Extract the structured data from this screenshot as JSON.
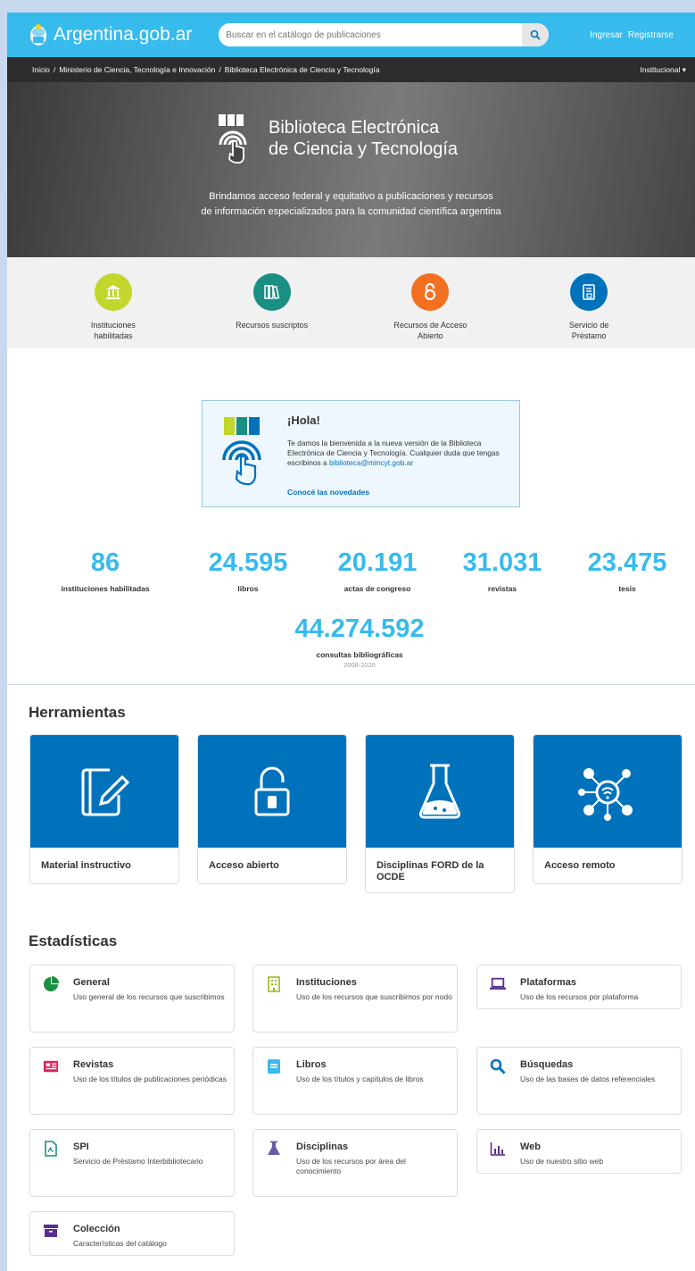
{
  "header": {
    "brand": "Argentina.gob.ar",
    "search_placeholder": "Buscar en el catálogo de publicaciones",
    "login": "Ingresar",
    "register": "Registrarse"
  },
  "breadcrumb": {
    "items": [
      "Inicio",
      "Ministerio de Ciencia, Tecnología e Innovación",
      "Biblioteca Electrónica de Ciencia y Tecnología"
    ],
    "institucional": "Institucional ▾"
  },
  "hero": {
    "title_line1": "Biblioteca Electrónica",
    "title_line2": "de Ciencia y Tecnología",
    "subtitle_line1": "Brindamos acceso federal y equitativo a publicaciones y recursos",
    "subtitle_line2": "de información especializados para la comunidad científica argentina"
  },
  "quick_links": [
    {
      "line1": "Instituciones",
      "line2": "habilitadas",
      "color": "#c2d62c",
      "icon": "institution-icon"
    },
    {
      "line1": "Recursos suscriptos",
      "line2": "",
      "color": "#1a8f83",
      "icon": "books-icon"
    },
    {
      "line1": "Recursos de Acceso",
      "line2": "Abierto",
      "color": "#f37021",
      "icon": "open-access-icon"
    },
    {
      "line1": "Servicio de",
      "line2": "Préstamo",
      "color": "#0072bb",
      "icon": "loan-icon"
    }
  ],
  "hola": {
    "title": "¡Hola!",
    "text": "Te damos la bienvenida a la nueva versión de la Biblioteca Electrónica de Ciencia y Tecnología. Cualquier duda que tengas escribinos a ",
    "email": "biblioteca@mincyt.gob.ar",
    "link": "Conocé las novedades"
  },
  "stats": {
    "instituciones": {
      "num": "86",
      "label": "instituciones habilitadas"
    },
    "libros": {
      "num": "24.595",
      "label": "libros"
    },
    "actas": {
      "num": "20.191",
      "label": "actas de congreso"
    },
    "revistas": {
      "num": "31.031",
      "label": "revistas"
    },
    "tesis": {
      "num": "23.475",
      "label": "tesis"
    },
    "consultas": {
      "num": "44.274.592",
      "label": "consultas bibliográficas",
      "years": "2008-2020"
    }
  },
  "herramientas": {
    "title": "Herramientas",
    "items": [
      {
        "label": "Material instructivo",
        "icon": "edit-document-icon"
      },
      {
        "label": "Acceso abierto",
        "icon": "unlock-icon"
      },
      {
        "label": "Disciplinas FORD de la OCDE",
        "icon": "flask-icon"
      },
      {
        "label": "Acceso remoto",
        "icon": "network-icon"
      }
    ]
  },
  "estadisticas": {
    "title": "Estadísticas",
    "items": [
      {
        "title": "General",
        "desc": "Uso general de los recursos que suscribimos",
        "icon": "pie-chart-icon",
        "color": "#1a8f43"
      },
      {
        "title": "Instituciones",
        "desc": "Uso de los recursos que suscribimos por nodo",
        "icon": "building-icon",
        "color": "#9cb81f"
      },
      {
        "title": "Plataformas",
        "desc": "Uso de los recursos por plataforma",
        "icon": "laptop-icon",
        "color": "#5b2d91"
      },
      {
        "title": "Revistas",
        "desc": "Uso de los títulos de publicaciones periódicas",
        "icon": "newspaper-icon",
        "color": "#e0245e"
      },
      {
        "title": "Libros",
        "desc": "Uso de los títulos y capítulos de libros",
        "icon": "book-icon",
        "color": "#37bbed"
      },
      {
        "title": "Búsquedas",
        "desc": "Uso de las bases de datos referenciales",
        "icon": "search-icon",
        "color": "#0072bb"
      },
      {
        "title": "SPI",
        "desc": "Servicio de Préstamo Interbibliotecario",
        "icon": "pdf-file-icon",
        "color": "#1a8f83"
      },
      {
        "title": "Disciplinas",
        "desc": "Uso de los recursos por área del conocimiento",
        "icon": "flask-icon",
        "color": "#6a5aa8"
      },
      {
        "title": "Web",
        "desc": "Uso de nuestro sitio web",
        "icon": "bar-chart-icon",
        "color": "#5b2d91"
      },
      {
        "title": "Colección",
        "desc": "Características del catálogo",
        "icon": "archive-icon",
        "color": "#5b2d91"
      }
    ]
  }
}
